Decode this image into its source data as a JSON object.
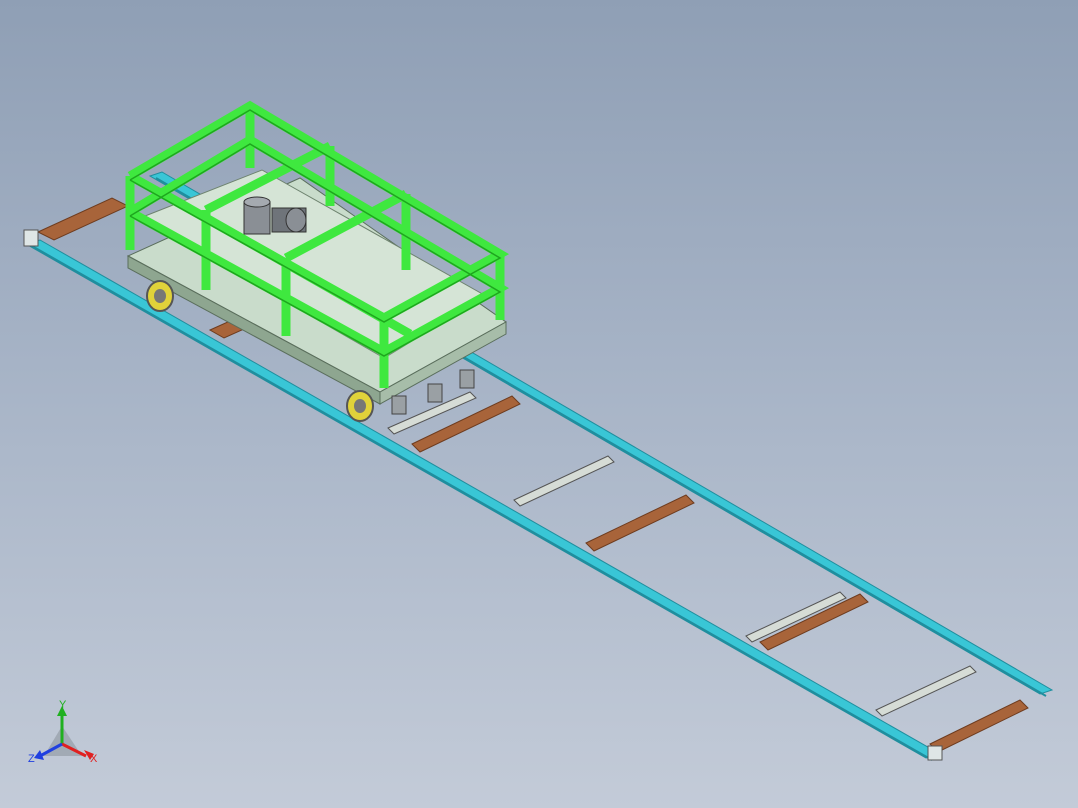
{
  "viewport": {
    "background_top": "#8f9fb5",
    "background_bottom": "#c3cbd8"
  },
  "model": {
    "rail_color": "#39c6d6",
    "rail_dark": "#1f8e9e",
    "sleeper_color": "#a8643a",
    "sleeper_dark": "#6e3c1f",
    "frame_color": "#3fe83f",
    "frame_dark": "#1ea61e",
    "platform_color": "#c9dccb",
    "platform_dark": "#8ea690",
    "wheel_color": "#e0d23a",
    "motor_color": "#8a8f95"
  },
  "triad": {
    "x_label": "X",
    "y_label": "Y",
    "z_label": "Z",
    "x_color": "#e02020",
    "y_color": "#20b020",
    "z_color": "#2040e0"
  }
}
